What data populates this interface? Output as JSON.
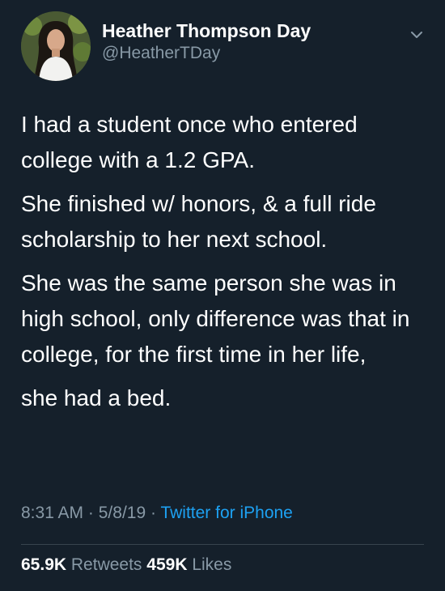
{
  "author": {
    "display_name": "Heather Thompson Day",
    "handle": "@HeatherTDay"
  },
  "tweet": {
    "paragraphs": [
      "I had a student once who entered college with a 1.2 GPA.",
      "She finished w/ honors, & a full ride scholarship to her next school.",
      "She was the same person she was in high school, only difference was that in college, for the first time in her life,",
      "she had a bed."
    ]
  },
  "meta": {
    "time": "8:31 AM",
    "date": "5/8/19",
    "separator": "·",
    "source": "Twitter for iPhone"
  },
  "stats": {
    "retweets_count": "65.9K",
    "retweets_label": "Retweets",
    "likes_count": "459K",
    "likes_label": "Likes"
  },
  "icons": {
    "menu": "chevron-down-icon"
  },
  "colors": {
    "background": "#15202b",
    "secondary_text": "#8899a6",
    "accent": "#1da1f2",
    "divider": "#38444d"
  }
}
